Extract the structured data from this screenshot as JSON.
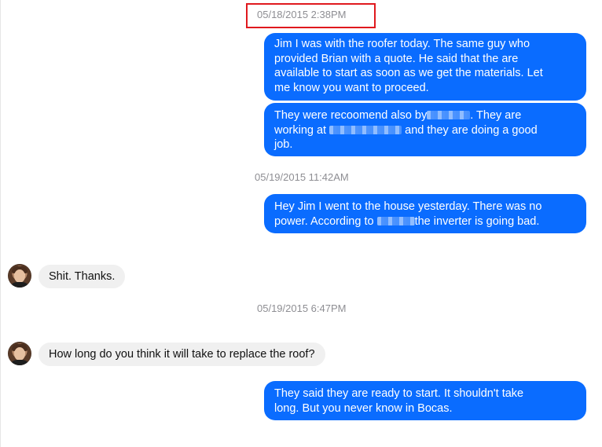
{
  "conversation": {
    "timestamps": {
      "t1": "05/18/2015 2:38PM",
      "t2": "05/19/2015 11:42AM",
      "t3": "05/19/2015 6:47PM"
    },
    "messages": {
      "m1": {
        "l1": "Jim I was with the roofer today. The same guy who",
        "l2": "provided Brian with a quote. He said that the are",
        "l3": "available to start as soon as we get the materials. Let",
        "l4": "me know you want to proceed."
      },
      "m2": {
        "l1a": "They were recoomend also by",
        "l1b": ". They are",
        "l2a": "working at",
        "l2b": "and they are doing a good",
        "l3": "job."
      },
      "m3": {
        "l1": "Hey Jim I went to the house yesterday. There was no",
        "l2a": "power. According to",
        "l2b": "the inverter is going bad."
      },
      "m4": "Shit.  Thanks.",
      "m5": "How long do you think it will take to replace the roof?",
      "m6": {
        "l1": "They said they are ready to start. It shouldn't take",
        "l2": "long. But you never know in Bocas."
      }
    },
    "colors": {
      "outgoing_bubble": "#0a6cff",
      "incoming_bubble": "#f0f0f0",
      "timestamp_text": "#8e8e93",
      "highlight_box": "#e0191e"
    }
  }
}
